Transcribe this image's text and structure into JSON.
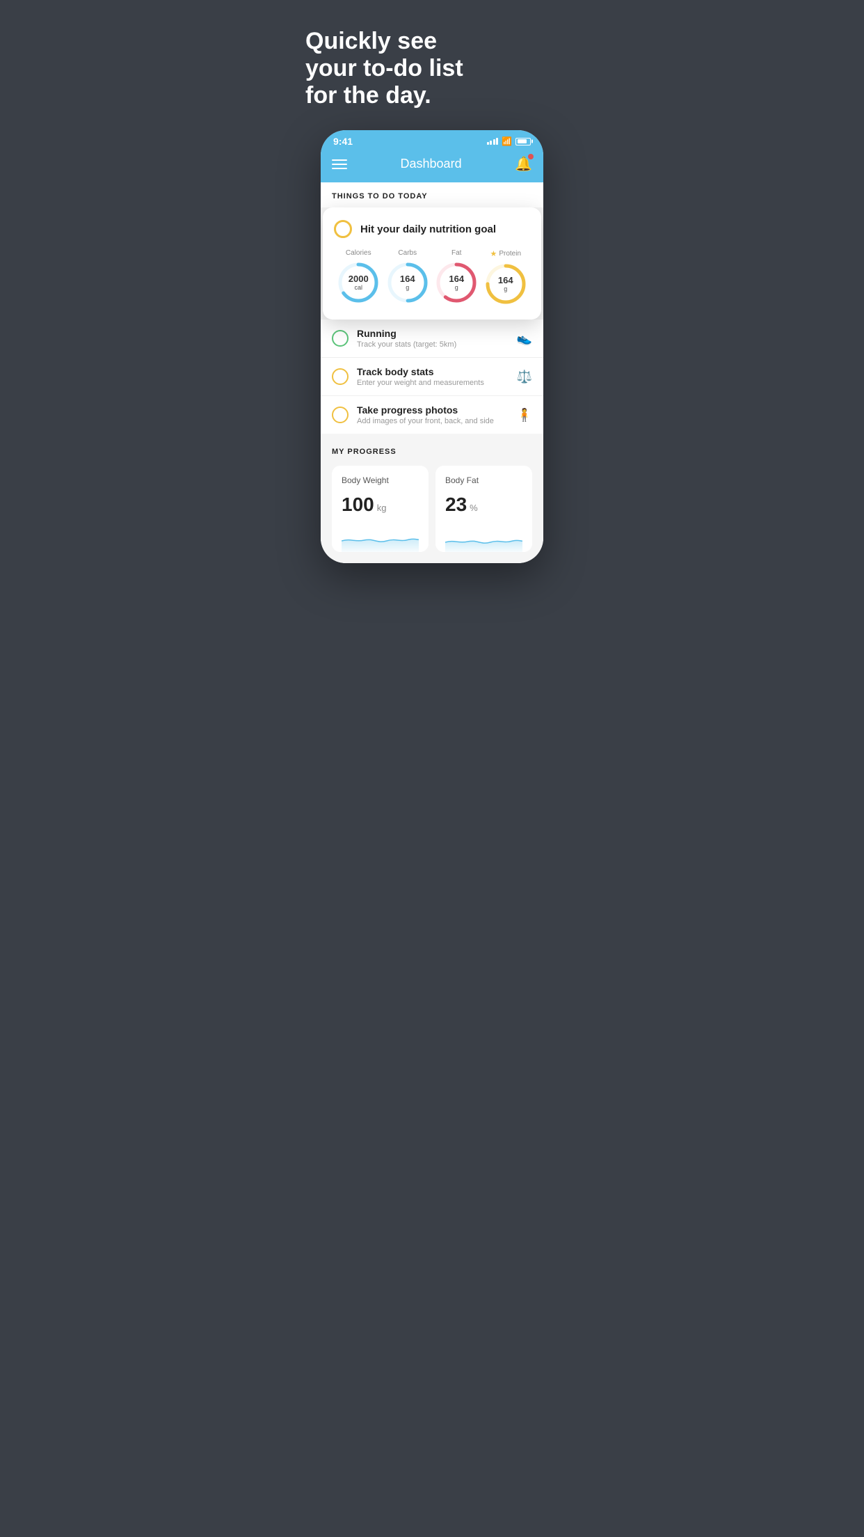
{
  "hero": {
    "line1": "Quickly see",
    "line2": "your to-do list",
    "line3": "for the day."
  },
  "statusBar": {
    "time": "9:41",
    "batteryLevel": 80
  },
  "header": {
    "title": "Dashboard"
  },
  "thingsSection": {
    "heading": "THINGS TO DO TODAY"
  },
  "nutritionCard": {
    "title": "Hit your daily nutrition goal",
    "macros": [
      {
        "label": "Calories",
        "value": "2000",
        "unit": "cal",
        "color": "#5bbfea",
        "pct": 65
      },
      {
        "label": "Carbs",
        "value": "164",
        "unit": "g",
        "color": "#5bbfea",
        "pct": 50
      },
      {
        "label": "Fat",
        "value": "164",
        "unit": "g",
        "color": "#e05870",
        "pct": 60
      },
      {
        "label": "Protein",
        "value": "164",
        "unit": "g",
        "color": "#f0c040",
        "pct": 75,
        "star": true
      }
    ]
  },
  "todoItems": [
    {
      "id": "running",
      "type": "green",
      "title": "Running",
      "subtitle": "Track your stats (target: 5km)",
      "icon": "shoe"
    },
    {
      "id": "body-stats",
      "type": "yellow",
      "title": "Track body stats",
      "subtitle": "Enter your weight and measurements",
      "icon": "scale"
    },
    {
      "id": "progress-photos",
      "type": "yellow",
      "title": "Take progress photos",
      "subtitle": "Add images of your front, back, and side",
      "icon": "person"
    }
  ],
  "progressSection": {
    "heading": "MY PROGRESS",
    "cards": [
      {
        "title": "Body Weight",
        "value": "100",
        "unit": "kg"
      },
      {
        "title": "Body Fat",
        "value": "23",
        "unit": "%"
      }
    ]
  }
}
